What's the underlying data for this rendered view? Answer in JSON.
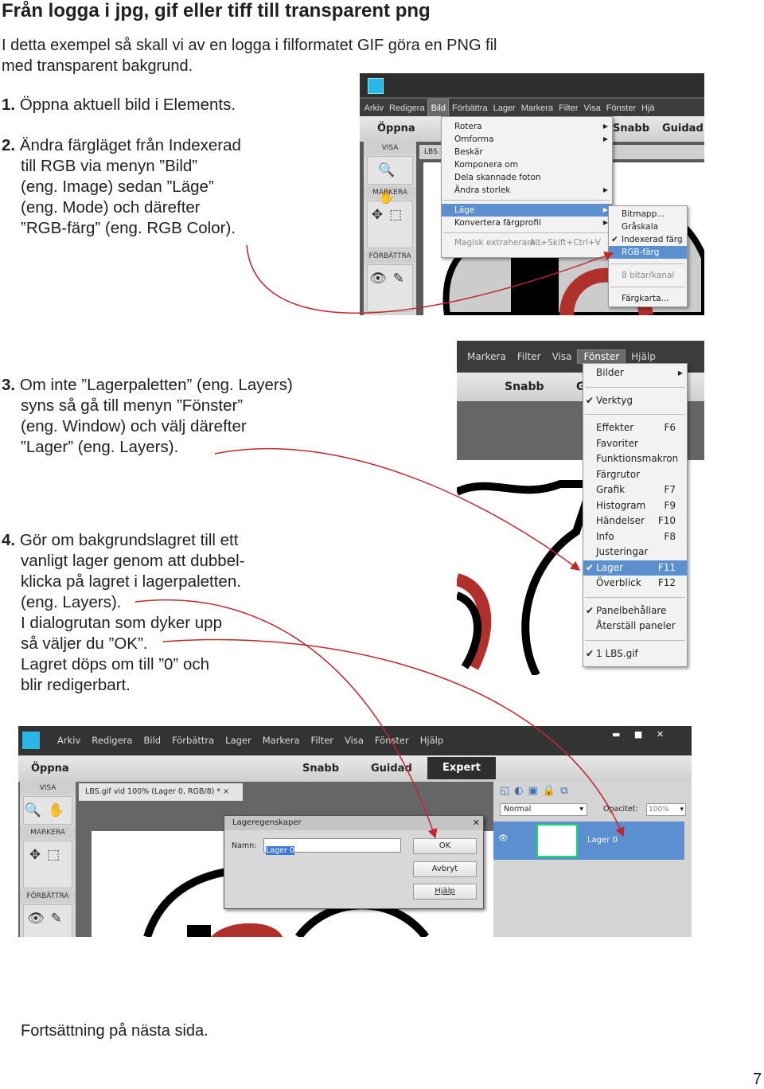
{
  "title": "Från logga i jpg, gif eller tiff till transparent png",
  "intro": [
    "I detta exempel så skall vi av en logga i filformatet GIF göra en PNG fil",
    "med transparent bakgrund."
  ],
  "steps": [
    {
      "num": "1.",
      "lines": [
        "Öppna aktuell bild i Elements."
      ]
    },
    {
      "num": "2.",
      "lines": [
        "Ändra färgläget från Indexerad",
        "till RGB via menyn ”Bild”",
        "(eng. Image) sedan ”Läge”",
        "(eng. Mode) och därefter",
        "”RGB-färg” (eng. RGB Color)."
      ]
    },
    {
      "num": "3.",
      "lines": [
        "Om inte ”Lagerpaletten” (eng. Layers)",
        "syns så gå till menyn ”Fönster”",
        "(eng. Window) och välj därefter",
        "”Lager” (eng. Layers)."
      ]
    },
    {
      "num": "4.",
      "lines": [
        "Gör om bakgrundslagret till ett",
        "vanligt lager genom att dubbel-",
        "klicka på lagret i lagerpaletten.",
        "(eng. Layers).",
        "I dialogrutan som dyker upp",
        "så väljer du ”OK”.",
        "Lagret döps om till ”0” och",
        "blir redigerbart."
      ]
    }
  ],
  "footer": "Fortsättning på nästa sida.",
  "page_number": "7",
  "colors": {
    "arrow": "#c0282d",
    "highlight": "#5b8fd0",
    "menubar": "#3c3c3c"
  },
  "shot1": {
    "menubar": [
      "Arkiv",
      "Redigera",
      "Bild",
      "Förbättra",
      "Lager",
      "Markera",
      "Filter",
      "Visa",
      "Fönster",
      "Hjä"
    ],
    "open": "Öppna",
    "snabb": "Snabb",
    "guidad": "Guidad",
    "tab": "LBS.",
    "tool_labels": [
      "VISA",
      "MARKERA",
      "FÖRBÄTTRA"
    ],
    "bild_menu": [
      "Rotera",
      "Omforma",
      "Beskär",
      "Komponera om",
      "Dela skannade foton",
      "Ändra storlek",
      "Läge",
      "Konvertera färgprofil",
      "Magisk extraherare...",
      "Alt+Skift+Ctrl+V"
    ],
    "lage_menu": [
      "Bitmapp...",
      "Gråskala",
      "Indexerad färg",
      "RGB-färg",
      "8 bitar/kanal",
      "Färgkarta..."
    ]
  },
  "shot2": {
    "menubar": [
      "Markera",
      "Filter",
      "Visa",
      "Fönster",
      "Hjälp"
    ],
    "snabb": "Snabb",
    "g": "G",
    "items": [
      {
        "label": "Bilder",
        "key": "",
        "check": false,
        "sub": true
      },
      {
        "label": "Verktyg",
        "key": "",
        "check": true
      },
      {
        "label": "Effekter",
        "key": "F6"
      },
      {
        "label": "Favoriter",
        "key": ""
      },
      {
        "label": "Funktionsmakron",
        "key": ""
      },
      {
        "label": "Färgrutor",
        "key": ""
      },
      {
        "label": "Grafik",
        "key": "F7"
      },
      {
        "label": "Histogram",
        "key": "F9"
      },
      {
        "label": "Händelser",
        "key": "F10"
      },
      {
        "label": "Info",
        "key": "F8"
      },
      {
        "label": "Justeringar",
        "key": ""
      },
      {
        "label": "Lager",
        "key": "F11",
        "check": true,
        "hl": true
      },
      {
        "label": "Överblick",
        "key": "F12"
      },
      {
        "label": "Panelbehållare",
        "key": "",
        "check": true
      },
      {
        "label": "Återställ paneler",
        "key": ""
      },
      {
        "label": "1 LBS.gif",
        "key": "",
        "check": true
      }
    ]
  },
  "shot3": {
    "menubar": [
      "Arkiv",
      "Redigera",
      "Bild",
      "Förbättra",
      "Lager",
      "Markera",
      "Filter",
      "Visa",
      "Fönster",
      "Hjälp"
    ],
    "window_buttons": [
      "▬",
      "■",
      "✕"
    ],
    "open": "Öppna",
    "snabb": "Snabb",
    "guidad": "Guidad",
    "expert": "Expert",
    "tab": "LBS.gif vid 100% (Lager 0, RGB/8) *",
    "tab_close": "×",
    "tool_labels": [
      "VISA",
      "MARKERA",
      "FÖRBÄTTRA"
    ],
    "blend_mode": "Normal",
    "opacity_label": "Opacitet:",
    "opacity_value": "100%",
    "layer_name": "Lager 0",
    "dialog": {
      "title": "Lageregenskaper",
      "close": "✕",
      "name_label": "Namn:",
      "name_value": "Lager 0",
      "ok": "OK",
      "cancel": "Avbryt",
      "help": "Hjälp"
    }
  }
}
